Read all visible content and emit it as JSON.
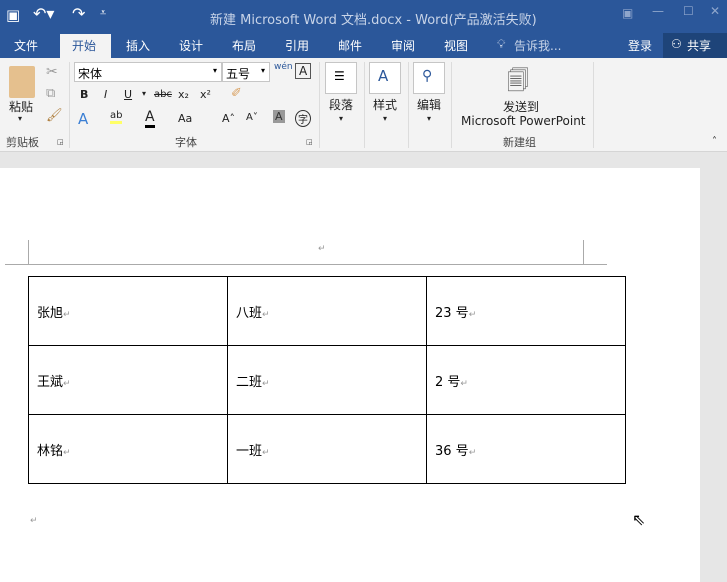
{
  "title": "新建 Microsoft Word 文档.docx - Word(产品激活失败)",
  "tabs": [
    "文件",
    "开始",
    "插入",
    "设计",
    "布局",
    "引用",
    "邮件",
    "审阅",
    "视图"
  ],
  "tell_me": "告诉我...",
  "login": "登录",
  "share": "共享",
  "ribbon": {
    "paste": "粘贴",
    "clipboard": "剪贴板",
    "font_name": "宋体",
    "font_size": "五号",
    "font_group": "字体",
    "bold": "B",
    "italic": "I",
    "underline": "U",
    "strike": "abc",
    "sub": "x₂",
    "sup": "x²",
    "case": "Aa",
    "paragraph": "段落",
    "styles": "样式",
    "editing": "编辑",
    "send_to": "发送到",
    "powerpoint": "Microsoft PowerPoint",
    "new_group": "新建组"
  },
  "table": [
    [
      "张旭",
      "八班",
      "23 号"
    ],
    [
      "王斌",
      "二班",
      "2 号"
    ],
    [
      "林铭",
      "一班",
      "36 号"
    ]
  ],
  "para_mark": "↵"
}
